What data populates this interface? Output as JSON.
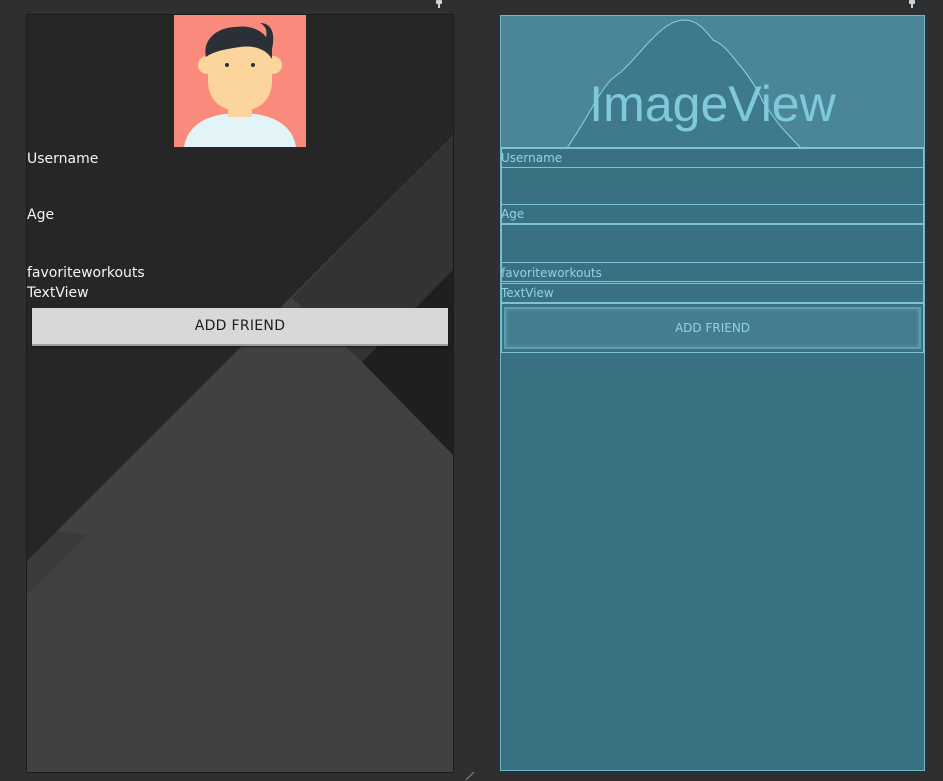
{
  "design": {
    "username_label": "Username",
    "age_label": "Age",
    "favorite_workouts_label": "favoriteworkouts",
    "textview_label": "TextView",
    "add_friend_button": "ADD FRIEND"
  },
  "blueprint": {
    "image_placeholder": "ImageView",
    "username_label": "Username",
    "age_label": "Age",
    "favorite_workouts_label": "favoriteworkouts",
    "textview_label": "TextView",
    "add_friend_button": "ADD FRIEND"
  },
  "colors": {
    "avatar_bg": "#fa8a7c",
    "blueprint_bg": "#3a7182",
    "blueprint_line": "#7cc3d6",
    "button_bg": "#d7d8d8"
  }
}
